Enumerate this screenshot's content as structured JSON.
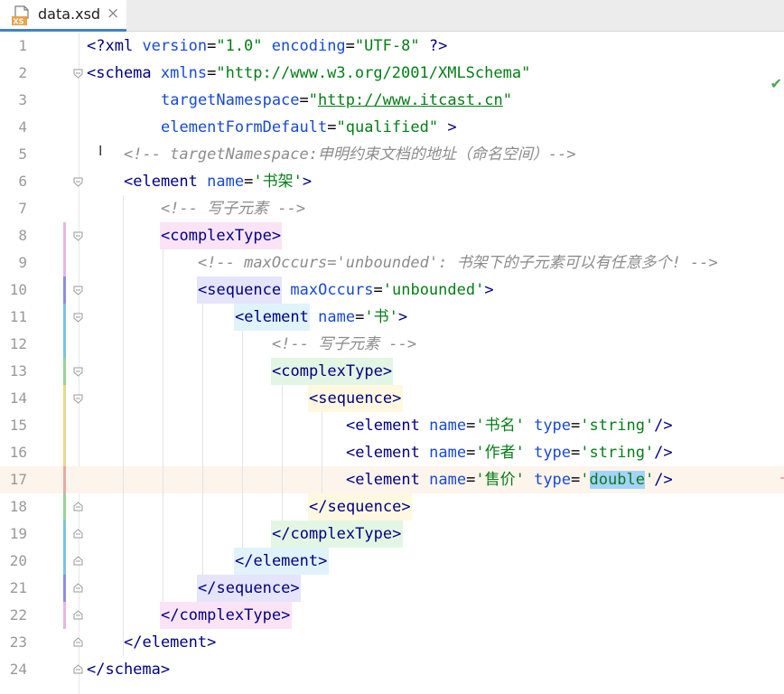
{
  "tab": {
    "icon_text": "XS",
    "filename": "data.xsd",
    "close": "×"
  },
  "status": {
    "inspection_ok": "✔"
  },
  "lines": [
    {
      "n": "1",
      "t": "<?xml version=\"1.0\" encoding=\"UTF-8\" ?>"
    },
    {
      "n": "2",
      "t": "<schema xmlns=\"http://www.w3.org/2001/XMLSchema\""
    },
    {
      "n": "3",
      "t": "targetNamespace=\"http://www.itcast.cn\""
    },
    {
      "n": "4",
      "t": "elementFormDefault=\"qualified\" >"
    },
    {
      "n": "5",
      "t": "<!-- targetNamespace:申明约束文档的地址（命名空间）-->"
    },
    {
      "n": "6",
      "t": "<element name='书架'>"
    },
    {
      "n": "7",
      "t": "<!-- 写子元素 -->"
    },
    {
      "n": "8",
      "t": "<complexType>"
    },
    {
      "n": "9",
      "t": "<!-- maxOccurs='unbounded': 书架下的子元素可以有任意多个! -->"
    },
    {
      "n": "10",
      "t": "<sequence maxOccurs='unbounded'>"
    },
    {
      "n": "11",
      "t": "<element name='书'>"
    },
    {
      "n": "12",
      "t": "<!-- 写子元素 -->"
    },
    {
      "n": "13",
      "t": "<complexType>"
    },
    {
      "n": "14",
      "t": "<sequence>"
    },
    {
      "n": "15",
      "t": "<element name='书名' type='string'/>"
    },
    {
      "n": "16",
      "t": "<element name='作者' type='string'/>"
    },
    {
      "n": "17",
      "t": "<element name='售价' type='double'/>"
    },
    {
      "n": "18",
      "t": "</sequence>"
    },
    {
      "n": "19",
      "t": "</complexType>"
    },
    {
      "n": "20",
      "t": "</element>"
    },
    {
      "n": "21",
      "t": "</sequence>"
    },
    {
      "n": "22",
      "t": "</complexType>"
    },
    {
      "n": "23",
      "t": "</element>"
    },
    {
      "n": "24",
      "t": "</schema>"
    }
  ],
  "current_line": "17",
  "selected_token": "double",
  "colors": {
    "tag": "#000080",
    "attribute": "#174ad4",
    "value": "#067d17",
    "comment": "#8c8c8c",
    "current_line_bg": "#fdf4ec",
    "selection_bg": "#a6d2ff",
    "tab_underline": "#4083c9"
  }
}
